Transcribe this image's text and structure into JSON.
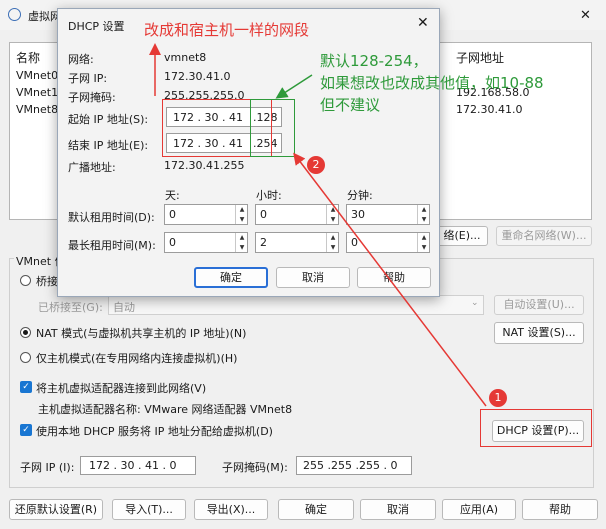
{
  "main": {
    "title": "虚拟网",
    "columns": {
      "name": "名称",
      "subnet": "子网地址"
    },
    "rows": [
      {
        "name": "VMnet0",
        "subnet": ""
      },
      {
        "name": "VMnet1",
        "subnet": "192.168.58.0"
      },
      {
        "name": "VMnet8",
        "subnet": "172.30.41.0"
      }
    ],
    "add_network_label": "络(E)...",
    "rename_network_label": "重命名网络(W)...",
    "vmnet_info_label": "VMnet 信",
    "bridge_label": "桥接",
    "bridged_to_label": "已桥接至(G):",
    "bridged_to_value": "自动",
    "auto_settings_label": "自动设置(U)...",
    "nat_label": "NAT 模式(与虚拟机共享主机的 IP 地址)(N)",
    "nat_settings_label": "NAT 设置(S)...",
    "hostonly_label": "仅主机模式(在专用网络内连接虚拟机)(H)",
    "connect_adapter_label": "将主机虚拟适配器连接到此网络(V)",
    "adapter_name_label": "主机虚拟适配器名称: VMware 网络适配器 VMnet8",
    "use_dhcp_label": "使用本地 DHCP 服务将 IP 地址分配给虚拟机(D)",
    "dhcp_settings_label": "DHCP 设置(P)...",
    "subnet_ip_label": "子网 IP (I):",
    "subnet_ip_value": "172 . 30 . 41 . 0",
    "subnet_mask_label": "子网掩码(M):",
    "subnet_mask_value": "255 .255 .255 . 0",
    "restore_defaults_label": "还原默认设置(R)",
    "import_label": "导入(T)...",
    "export_label": "导出(X)...",
    "ok_label": "确定",
    "cancel_label": "取消",
    "apply_label": "应用(A)",
    "help_label": "帮助",
    "close_glyph": "✕"
  },
  "dhcp": {
    "title": "DHCP 设置",
    "close_glyph": "✕",
    "network_label": "网络:",
    "network_value": "vmnet8",
    "subnet_ip_label": "子网 IP:",
    "subnet_ip_value": "172.30.41.0",
    "subnet_mask_label": "子网掩码:",
    "subnet_mask_value": "255.255.255.0",
    "start_ip_label": "起始 IP 地址(S):",
    "start_ip_prefix": "172 . 30 . 41",
    "start_ip_last": ".128",
    "end_ip_label": "结束 IP 地址(E):",
    "end_ip_prefix": "172 . 30 . 41",
    "end_ip_last": ".254",
    "broadcast_label": "广播地址:",
    "broadcast_value": "172.30.41.255",
    "days_label": "天:",
    "hours_label": "小时:",
    "minutes_label": "分钟:",
    "default_lease_label": "默认租用时间(D):",
    "default_lease": {
      "days": "0",
      "hours": "0",
      "minutes": "30"
    },
    "max_lease_label": "最长租用时间(M):",
    "max_lease": {
      "days": "0",
      "hours": "2",
      "minutes": "0"
    },
    "ok_label": "确定",
    "cancel_label": "取消",
    "help_label": "帮助"
  },
  "annotations": {
    "top_note": "改成和宿主机一样的网段",
    "side_note_1": "默认128-254，",
    "side_note_2": "如果想改也改成其他值，如10-88",
    "side_note_3": "但不建议",
    "step1": "1",
    "step2": "2",
    "red_color": "#e53935",
    "green_color": "#2e9a3a"
  }
}
